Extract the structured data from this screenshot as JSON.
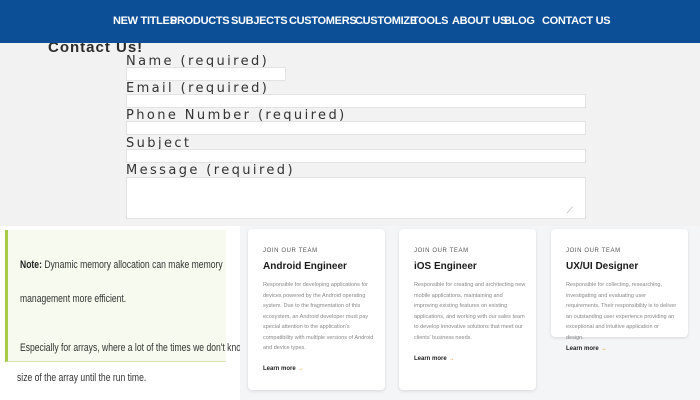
{
  "nav": {
    "items": [
      {
        "label": "NEW TITLES",
        "dropdown": false
      },
      {
        "label": "PRODUCTS",
        "dropdown": true
      },
      {
        "label": "SUBJECTS",
        "dropdown": true
      },
      {
        "label": "CUSTOMERS",
        "dropdown": true
      },
      {
        "label": "CUSTOMIZE",
        "dropdown": false
      },
      {
        "label": "TOOLS",
        "dropdown": false
      },
      {
        "label": "ABOUT US",
        "dropdown": false
      },
      {
        "label": "BLOG",
        "dropdown": false
      },
      {
        "label": "CONTACT US",
        "dropdown": false
      }
    ],
    "chevron": "⌄"
  },
  "form": {
    "title": "Contact Us!",
    "name_label": "Name (required)",
    "email_label": "Email (required)",
    "phone_label": "Phone Number (required)",
    "subject_label": "Subject",
    "message_label": "Message (required)",
    "name_value": "",
    "email_value": "",
    "phone_value": "",
    "subject_value": "",
    "message_value": ""
  },
  "note": {
    "bold": "Note:",
    "line1": "Dynamic memory allocation can make memory",
    "line2": "management more efficient.",
    "line3": "Especially for arrays, where a lot of the times we don't know the",
    "line4": "size of the array until the run time."
  },
  "jobs": {
    "cards": [
      {
        "eyebrow": "JOIN OUR TEAM",
        "title": "Android Engineer",
        "description": "Responsible for developing applications for devices powered by the Android operating system. Due to the fragmentation of this ecosystem, an Android developer must pay special attention to the application's compatibility with multiple versions of Android and device types.",
        "link": "Learn more"
      },
      {
        "eyebrow": "JOIN OUR TEAM",
        "title": "iOS Engineer",
        "description": "Responsible for creating and architecting new mobile applications, maintaining and improving existing features on existing applications, and working with our sales team to develop innovative solutions that meet our clients' business needs.",
        "link": "Learn more"
      },
      {
        "eyebrow": "JOIN OUR TEAM",
        "title": "UX/UI Designer",
        "description": "Responsible for collecting, researching, investigating and evaluating user requirements. Their responsibility is to deliver an outstanding user experience providing an exceptional and intuitive application or design.",
        "link": "Learn more"
      }
    ],
    "arrow": "→"
  }
}
